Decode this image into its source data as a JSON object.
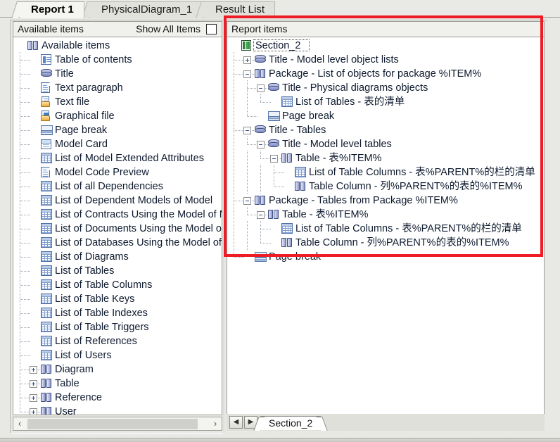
{
  "tabs": [
    {
      "label": "Report 1",
      "active": true
    },
    {
      "label": "PhysicalDiagram_1",
      "active": false
    },
    {
      "label": "Result List",
      "active": false
    }
  ],
  "left_panel": {
    "header": "Available items",
    "show_all_label": "Show All Items",
    "show_all_checked": false,
    "tree": [
      {
        "label": "Available items",
        "depth": 0,
        "icon": "book-icon",
        "expander": "none"
      },
      {
        "label": "Table of contents",
        "depth": 1,
        "icon": "toc-icon",
        "expander": "none"
      },
      {
        "label": "Title",
        "depth": 1,
        "icon": "title-icon",
        "expander": "none"
      },
      {
        "label": "Text paragraph",
        "depth": 1,
        "icon": "doc-icon",
        "expander": "none"
      },
      {
        "label": "Text file",
        "depth": 1,
        "icon": "file-icon",
        "expander": "none"
      },
      {
        "label": "Graphical file",
        "depth": 1,
        "icon": "graphic-file-icon",
        "expander": "none"
      },
      {
        "label": "Page break",
        "depth": 1,
        "icon": "page-break-icon",
        "expander": "none"
      },
      {
        "label": "Model Card",
        "depth": 1,
        "icon": "card-icon",
        "expander": "none"
      },
      {
        "label": "List of Model Extended Attributes",
        "depth": 1,
        "icon": "grid-icon",
        "expander": "none"
      },
      {
        "label": "Model Code Preview",
        "depth": 1,
        "icon": "doc-icon",
        "expander": "none"
      },
      {
        "label": "List of all Dependencies",
        "depth": 1,
        "icon": "grid-icon",
        "expander": "none"
      },
      {
        "label": "List of Dependent Models of Model",
        "depth": 1,
        "icon": "grid-icon",
        "expander": "none"
      },
      {
        "label": "List of Contracts Using the Model of Model",
        "depth": 1,
        "icon": "grid-icon",
        "expander": "none"
      },
      {
        "label": "List of Documents Using the Model of Model",
        "depth": 1,
        "icon": "grid-icon",
        "expander": "none"
      },
      {
        "label": "List of Databases Using the Model of Model",
        "depth": 1,
        "icon": "grid-icon",
        "expander": "none"
      },
      {
        "label": "List of Diagrams",
        "depth": 1,
        "icon": "grid-icon",
        "expander": "none"
      },
      {
        "label": "List of Tables",
        "depth": 1,
        "icon": "grid-icon",
        "expander": "none"
      },
      {
        "label": "List of Table Columns",
        "depth": 1,
        "icon": "grid-icon",
        "expander": "none"
      },
      {
        "label": "List of Table Keys",
        "depth": 1,
        "icon": "grid-icon",
        "expander": "none"
      },
      {
        "label": "List of Table Indexes",
        "depth": 1,
        "icon": "grid-icon",
        "expander": "none"
      },
      {
        "label": "List of Table Triggers",
        "depth": 1,
        "icon": "grid-icon",
        "expander": "none"
      },
      {
        "label": "List of References",
        "depth": 1,
        "icon": "grid-icon",
        "expander": "none"
      },
      {
        "label": "List of Users",
        "depth": 1,
        "icon": "grid-icon",
        "expander": "none"
      },
      {
        "label": "Diagram",
        "depth": 1,
        "icon": "book-icon",
        "expander": "plus"
      },
      {
        "label": "Table",
        "depth": 1,
        "icon": "book-icon",
        "expander": "plus"
      },
      {
        "label": "Reference",
        "depth": 1,
        "icon": "book-icon",
        "expander": "plus"
      },
      {
        "label": "User",
        "depth": 1,
        "icon": "book-icon",
        "expander": "plus"
      }
    ],
    "scroll_left_arrow": "‹",
    "scroll_right_arrow": "›"
  },
  "right_panel": {
    "header": "Report items",
    "tree": [
      {
        "label": "Section_2",
        "depth": 0,
        "icon": "section-icon",
        "expander": "none",
        "selected": true
      },
      {
        "label": "Title - Model level object lists",
        "depth": 1,
        "icon": "title-icon",
        "expander": "plus"
      },
      {
        "label": "Package - List of objects for package %ITEM%",
        "depth": 1,
        "icon": "book-icon",
        "expander": "minus"
      },
      {
        "label": "Title - Physical diagrams objects",
        "depth": 2,
        "icon": "title-icon",
        "expander": "minus"
      },
      {
        "label": "List of Tables - 表的清单",
        "depth": 3,
        "icon": "grid-icon",
        "expander": "none"
      },
      {
        "label": "Page break",
        "depth": 2,
        "icon": "page-break-icon",
        "expander": "none"
      },
      {
        "label": "Title - Tables",
        "depth": 1,
        "icon": "title-icon",
        "expander": "minus"
      },
      {
        "label": "Title - Model level tables",
        "depth": 2,
        "icon": "title-icon",
        "expander": "minus"
      },
      {
        "label": "Table - 表%ITEM%",
        "depth": 3,
        "icon": "book-icon",
        "expander": "minus"
      },
      {
        "label": "List of Table Columns - 表%PARENT%的栏的清单",
        "depth": 4,
        "icon": "grid-icon",
        "expander": "none"
      },
      {
        "label": "Table Column - 列%PARENT%的表的%ITEM%",
        "depth": 4,
        "icon": "book-icon",
        "expander": "none"
      },
      {
        "label": "Package - Tables from Package %ITEM%",
        "depth": 1,
        "icon": "book-icon",
        "expander": "minus"
      },
      {
        "label": "Table - 表%ITEM%",
        "depth": 2,
        "icon": "book-icon",
        "expander": "minus"
      },
      {
        "label": "List of Table Columns - 表%PARENT%的栏的清单",
        "depth": 3,
        "icon": "grid-icon",
        "expander": "none"
      },
      {
        "label": "Table Column - 列%PARENT%的表的%ITEM%",
        "depth": 3,
        "icon": "book-icon",
        "expander": "none"
      },
      {
        "label": "Page break",
        "depth": 1,
        "icon": "page-break-icon",
        "expander": "none"
      }
    ],
    "nav_prev": "◀",
    "nav_next": "▶",
    "sheet_tab": "Section_2"
  },
  "colors": {
    "highlight_rect": "#ee1c25",
    "panel_bg": "#f0f0ec",
    "tree_bg": "#ffffff",
    "text": "#0e1a2e"
  }
}
